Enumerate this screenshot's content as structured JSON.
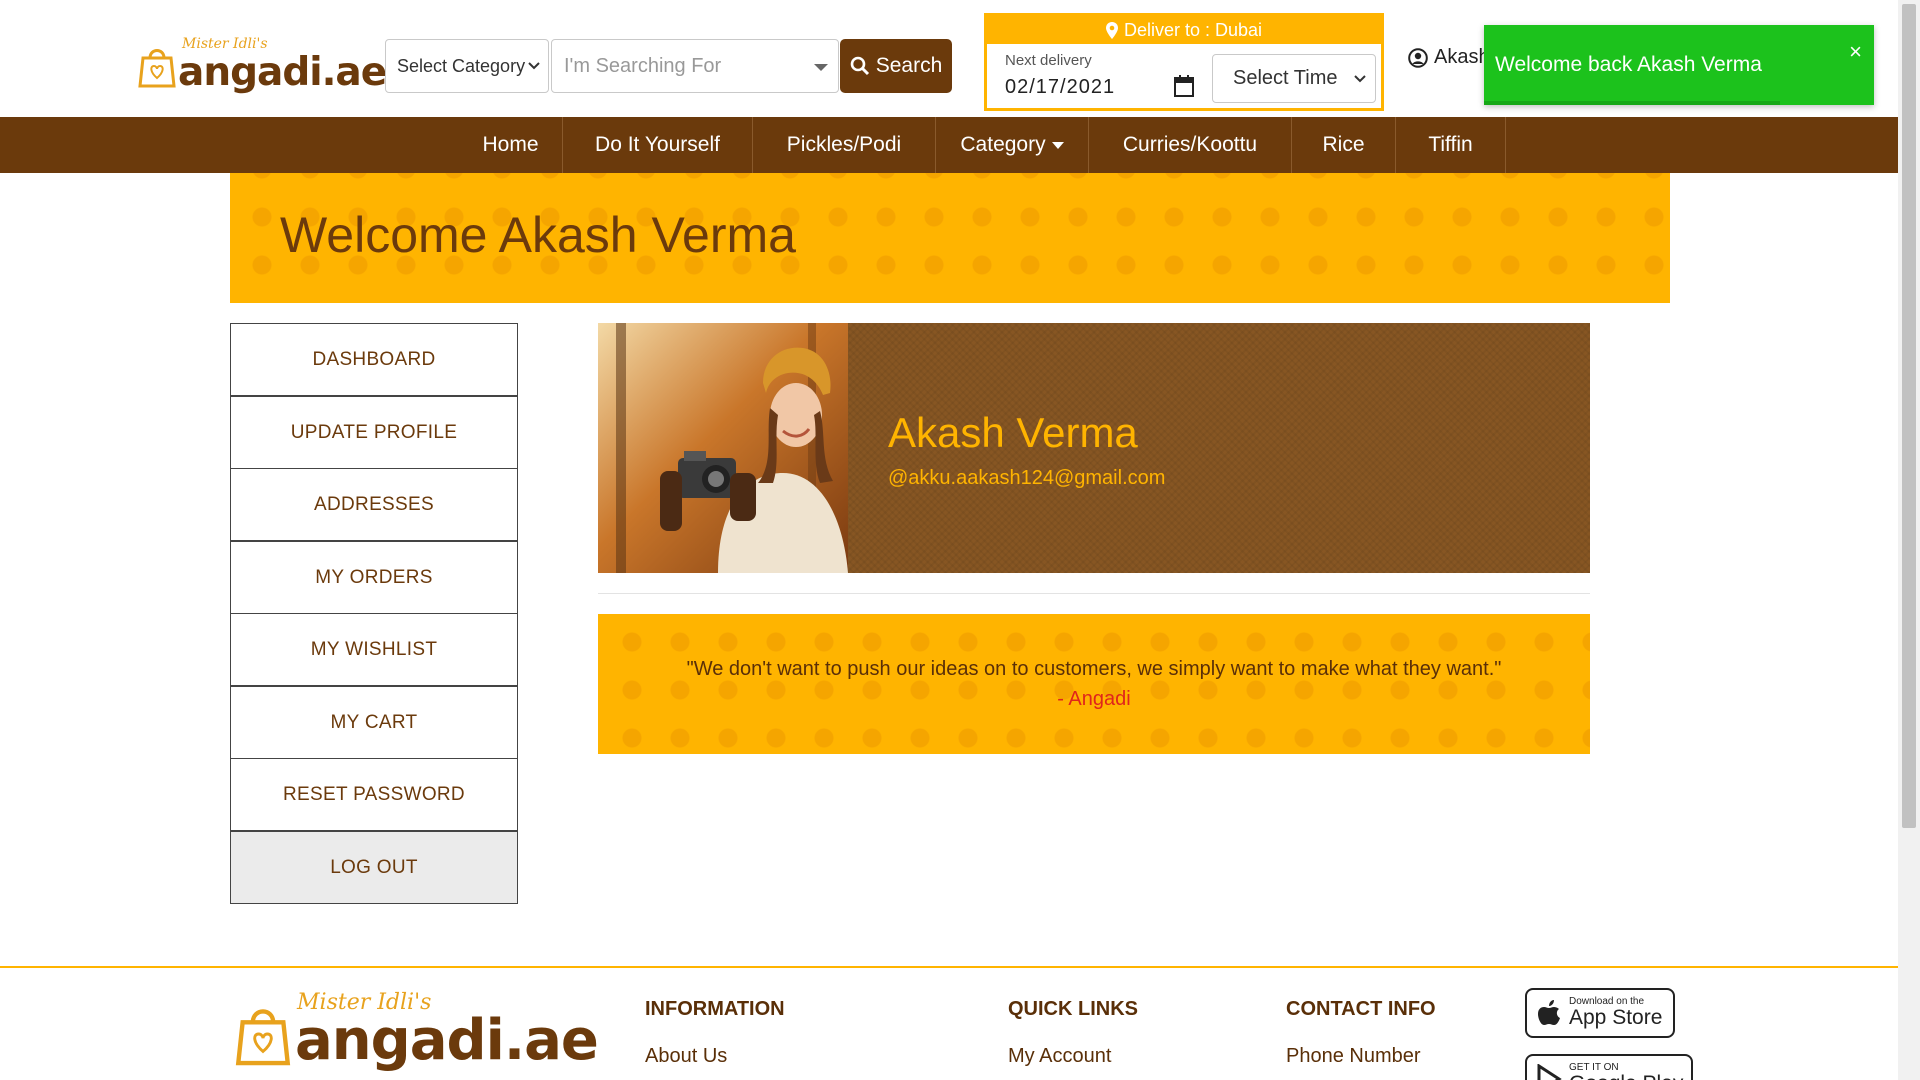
{
  "brand": {
    "script": "Mister Idli's",
    "name": "angadi.ae"
  },
  "search": {
    "category_label": "Select Category",
    "placeholder": "I'm Searching For",
    "button_label": "Search"
  },
  "delivery": {
    "header": "Deliver to : Dubai",
    "next_label": "Next delivery",
    "date": "02/17/2021",
    "time_label": "Select Time"
  },
  "user_menu": {
    "name": "Akash"
  },
  "nav": {
    "items": [
      "Home",
      "Do It Yourself",
      "Pickles/Podi",
      "Category",
      "Curries/Koottu",
      "Rice",
      "Tiffin"
    ]
  },
  "banner": {
    "title": "Welcome Akash Verma"
  },
  "sidebar": {
    "items": [
      "DASHBOARD",
      "UPDATE PROFILE",
      "ADDRESSES",
      "MY ORDERS",
      "MY WISHLIST",
      "MY CART",
      "RESET PASSWORD",
      "LOG OUT"
    ]
  },
  "profile": {
    "name": "Akash Verma",
    "email": "@akku.aakash124@gmail.com"
  },
  "quote": {
    "text": "\"We don't want to push our ideas on to customers, we simply want to make what they want.\"",
    "author": "- Angadi"
  },
  "toast": {
    "message": "Welcome back Akash Verma",
    "close": "×",
    "progress_fraction": 0.76
  },
  "footer": {
    "headings": [
      "INFORMATION",
      "QUICK LINKS",
      "CONTACT INFO"
    ],
    "links": [
      "About Us",
      "My Account",
      "Phone Number"
    ],
    "app_store": {
      "small": "Download on the",
      "big": "App Store"
    },
    "google_play": {
      "small": "GET IT ON",
      "big": "Google Play"
    }
  },
  "colors": {
    "brown": "#6b3a0c",
    "amber": "#ffb400",
    "toast_green": "#1cc21c",
    "quote_author": "#e0251b"
  }
}
